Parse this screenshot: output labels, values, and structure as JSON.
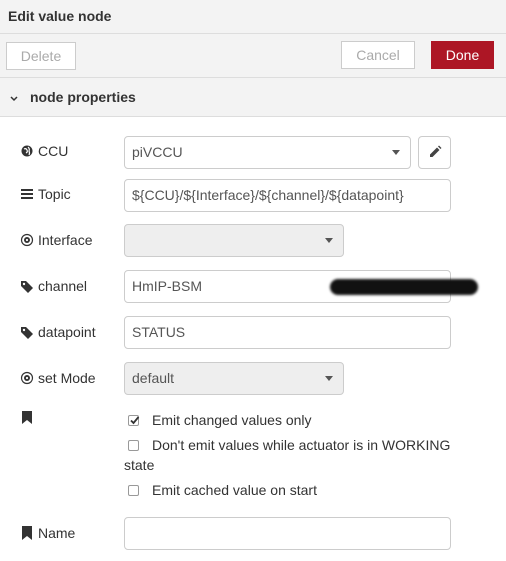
{
  "dialog": {
    "title": "Edit value node"
  },
  "toolbar": {
    "delete_label": "Delete",
    "cancel_label": "Cancel",
    "done_label": "Done"
  },
  "section": {
    "title": "node properties"
  },
  "form": {
    "ccu": {
      "label": "CCU",
      "value": "piVCCU"
    },
    "topic": {
      "label": "Topic",
      "value": "${CCU}/${Interface}/${channel}/${datapoint}"
    },
    "interface": {
      "label": "Interface",
      "value": ""
    },
    "channel": {
      "label": "channel",
      "value": "HmIP-BSM"
    },
    "datapoint": {
      "label": "datapoint",
      "value": "STATUS"
    },
    "set_mode": {
      "label": "set Mode",
      "value": "default"
    },
    "checkboxes": [
      {
        "label": "Emit changed values only",
        "checked": true
      },
      {
        "label": "Don't emit values while actuator is in WORKING",
        "label_cont": "state",
        "checked": false
      },
      {
        "label": "Emit cached value on start",
        "checked": false
      }
    ],
    "name": {
      "label": "Name",
      "value": ""
    }
  },
  "colors": {
    "accent": "#ad1625",
    "panel": "#f3f3f3"
  },
  "icons": [
    "globe-icon",
    "list-icon",
    "cog-icon",
    "tag-icon",
    "bookmark-icon",
    "pencil-icon",
    "chevron-down-icon"
  ]
}
